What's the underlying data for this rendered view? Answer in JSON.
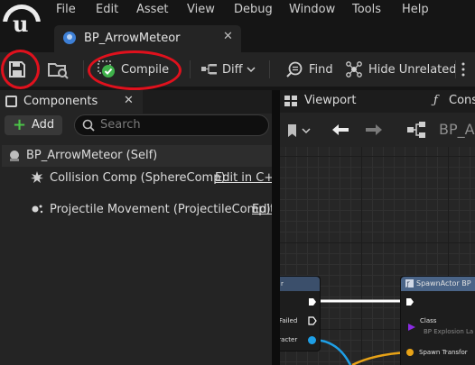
{
  "menu": {
    "items": [
      "File",
      "Edit",
      "Asset",
      "View",
      "Debug",
      "Window",
      "Tools",
      "Help"
    ]
  },
  "tab": {
    "title": "BP_ArrowMeteor",
    "close": "✕"
  },
  "toolbar": {
    "compile_label": "Compile",
    "diff_label": "Diff",
    "find_label": "Find",
    "hide_unrelated_label": "Hide Unrelated"
  },
  "components": {
    "panel_title": "Components",
    "close": "✕",
    "add_label": "Add",
    "search_placeholder": "Search",
    "self_label": "BP_ArrowMeteor (Self)",
    "items": [
      {
        "label": "Collision Comp (SphereComp)",
        "link": "Edit in C++"
      },
      {
        "label": "Projectile Movement (ProjectileComp)",
        "link": "Edit"
      }
    ]
  },
  "right_tabs": {
    "viewport": "Viewport",
    "construction": "Cons"
  },
  "graph_toolbar": {
    "breadcrumb": "BP_A"
  },
  "graph": {
    "left_node": {
      "title": "r",
      "pins": [
        "t Failed",
        "aracter"
      ]
    },
    "spawn_node": {
      "title": "SpawnActor BP",
      "class_label": "Class",
      "class_value": "BP Explosion La",
      "transform_label": "Spawn Transfor"
    }
  },
  "colors": {
    "annotation_ring": "#e0111d",
    "compile_ok": "#3fb14a",
    "add_plus": "#4cc548",
    "exec_wire": "#ffffff",
    "object_wire": "#1e9fe6",
    "transform_wire": "#e8a317"
  }
}
